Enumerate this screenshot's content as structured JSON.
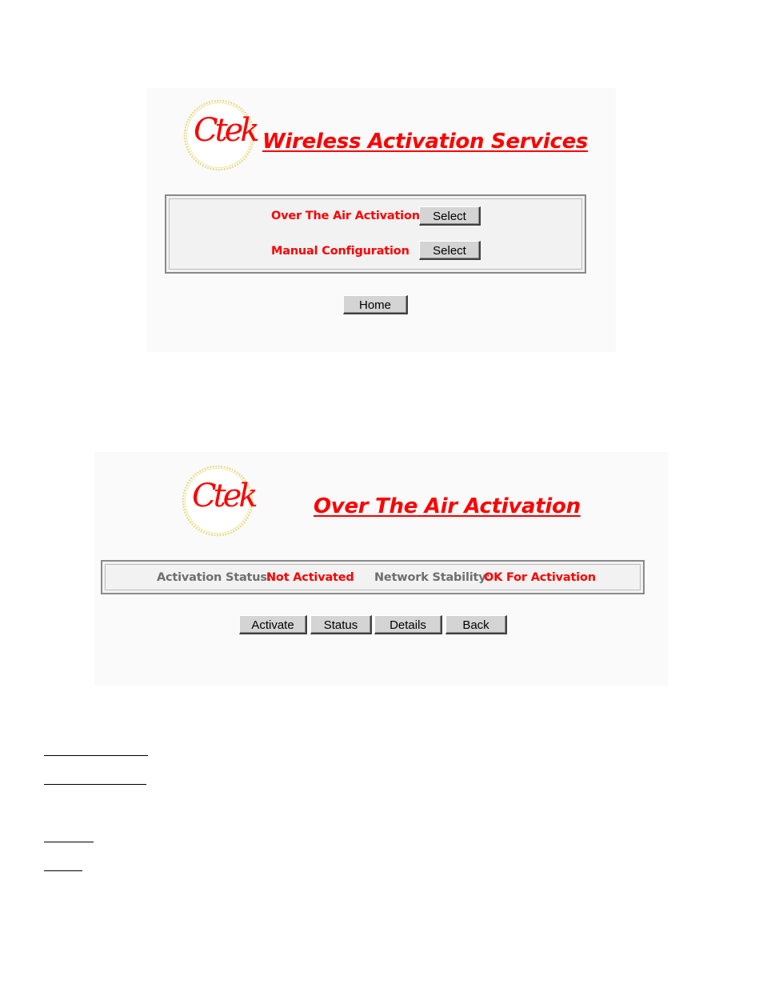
{
  "screen1": {
    "logo_text": "Ctek",
    "title": "Wireless Activation Services",
    "options": [
      {
        "label": "Over The Air Activation",
        "button": "Select"
      },
      {
        "label": "Manual Configuration",
        "button": "Select"
      }
    ],
    "home_button": "Home"
  },
  "screen2": {
    "logo_text": "Ctek",
    "title": "Over The Air Activation",
    "status_label": "Activation Status:",
    "status_value": "Not Activated",
    "stability_label": "Network Stability:",
    "stability_value": "OK For Activation",
    "buttons": [
      "Activate",
      "Status",
      "Details",
      "Back"
    ]
  },
  "colors": {
    "accent": "#ff0000",
    "label_grey": "#6f6f6f",
    "button_face": "#d4d4d4"
  }
}
